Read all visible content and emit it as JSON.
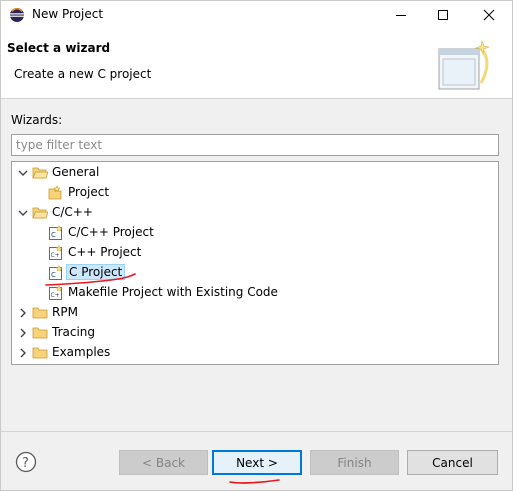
{
  "window": {
    "title": "New Project",
    "app_icon": "eclipse-icon"
  },
  "header": {
    "title": "Select a wizard",
    "description": "Create a new C project",
    "banner_icon": "new-wizard-banner-icon"
  },
  "wizards": {
    "label": "Wizards:",
    "filter_placeholder": "type filter text",
    "tree": [
      {
        "label": "General",
        "type": "folder",
        "expanded": true,
        "level": 0
      },
      {
        "label": "Project",
        "type": "project",
        "level": 1
      },
      {
        "label": "C/C++",
        "type": "folder",
        "expanded": true,
        "level": 0
      },
      {
        "label": "C/C++ Project",
        "type": "c-project",
        "level": 1
      },
      {
        "label": "C++ Project",
        "type": "c-project",
        "level": 1
      },
      {
        "label": "C Project",
        "type": "c-project",
        "level": 1,
        "selected": true
      },
      {
        "label": "Makefile Project with Existing Code",
        "type": "c-project",
        "level": 1
      },
      {
        "label": "RPM",
        "type": "folder",
        "expanded": false,
        "level": 0
      },
      {
        "label": "Tracing",
        "type": "folder",
        "expanded": false,
        "level": 0
      },
      {
        "label": "Examples",
        "type": "folder",
        "expanded": false,
        "level": 0
      }
    ]
  },
  "buttons": {
    "help_icon": "help-icon",
    "back": "< Back",
    "next": "Next >",
    "finish": "Finish",
    "cancel": "Cancel"
  },
  "colors": {
    "folder": "#e8b64a",
    "annotation": "#e8161d",
    "default_button_border": "#0078d7"
  }
}
